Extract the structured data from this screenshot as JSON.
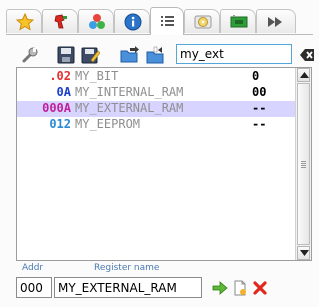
{
  "tabs": [
    {
      "icon": "star-icon",
      "active": false
    },
    {
      "icon": "chip-icon",
      "active": false
    },
    {
      "icon": "cluster-icon",
      "active": false
    },
    {
      "icon": "info-icon",
      "active": false
    },
    {
      "icon": "list-icon",
      "active": true
    },
    {
      "icon": "disc-icon",
      "active": false
    },
    {
      "icon": "board-icon",
      "active": false
    },
    {
      "icon": "fast-forward-icon",
      "active": false
    }
  ],
  "toolbar": {
    "search_value": "my_ext",
    "buttons": [
      "wrench-icon",
      "save-icon",
      "save-as-icon",
      "open-folder-icon",
      "import-icon"
    ]
  },
  "registers": [
    {
      "addr": ".02",
      "name": "MY_BIT",
      "value": "0",
      "addr_color": "#e53030",
      "selected": false
    },
    {
      "addr": "0A",
      "name": "MY_INTERNAL_RAM",
      "value": "00",
      "addr_color": "#1e3ecf",
      "selected": false
    },
    {
      "addr": "000A",
      "name": "MY_EXTERNAL_RAM",
      "value": "--",
      "addr_color": "#c21f9c",
      "selected": true
    },
    {
      "addr": "012",
      "name": "MY_EEPROM",
      "value": "--",
      "addr_color": "#2a8ad6",
      "selected": false
    }
  ],
  "name_color": "#8f8f8f",
  "editor": {
    "addr_label": "Addr",
    "name_label": "Register name",
    "addr_value": "000",
    "name_value": "MY_EXTERNAL_RAM"
  }
}
